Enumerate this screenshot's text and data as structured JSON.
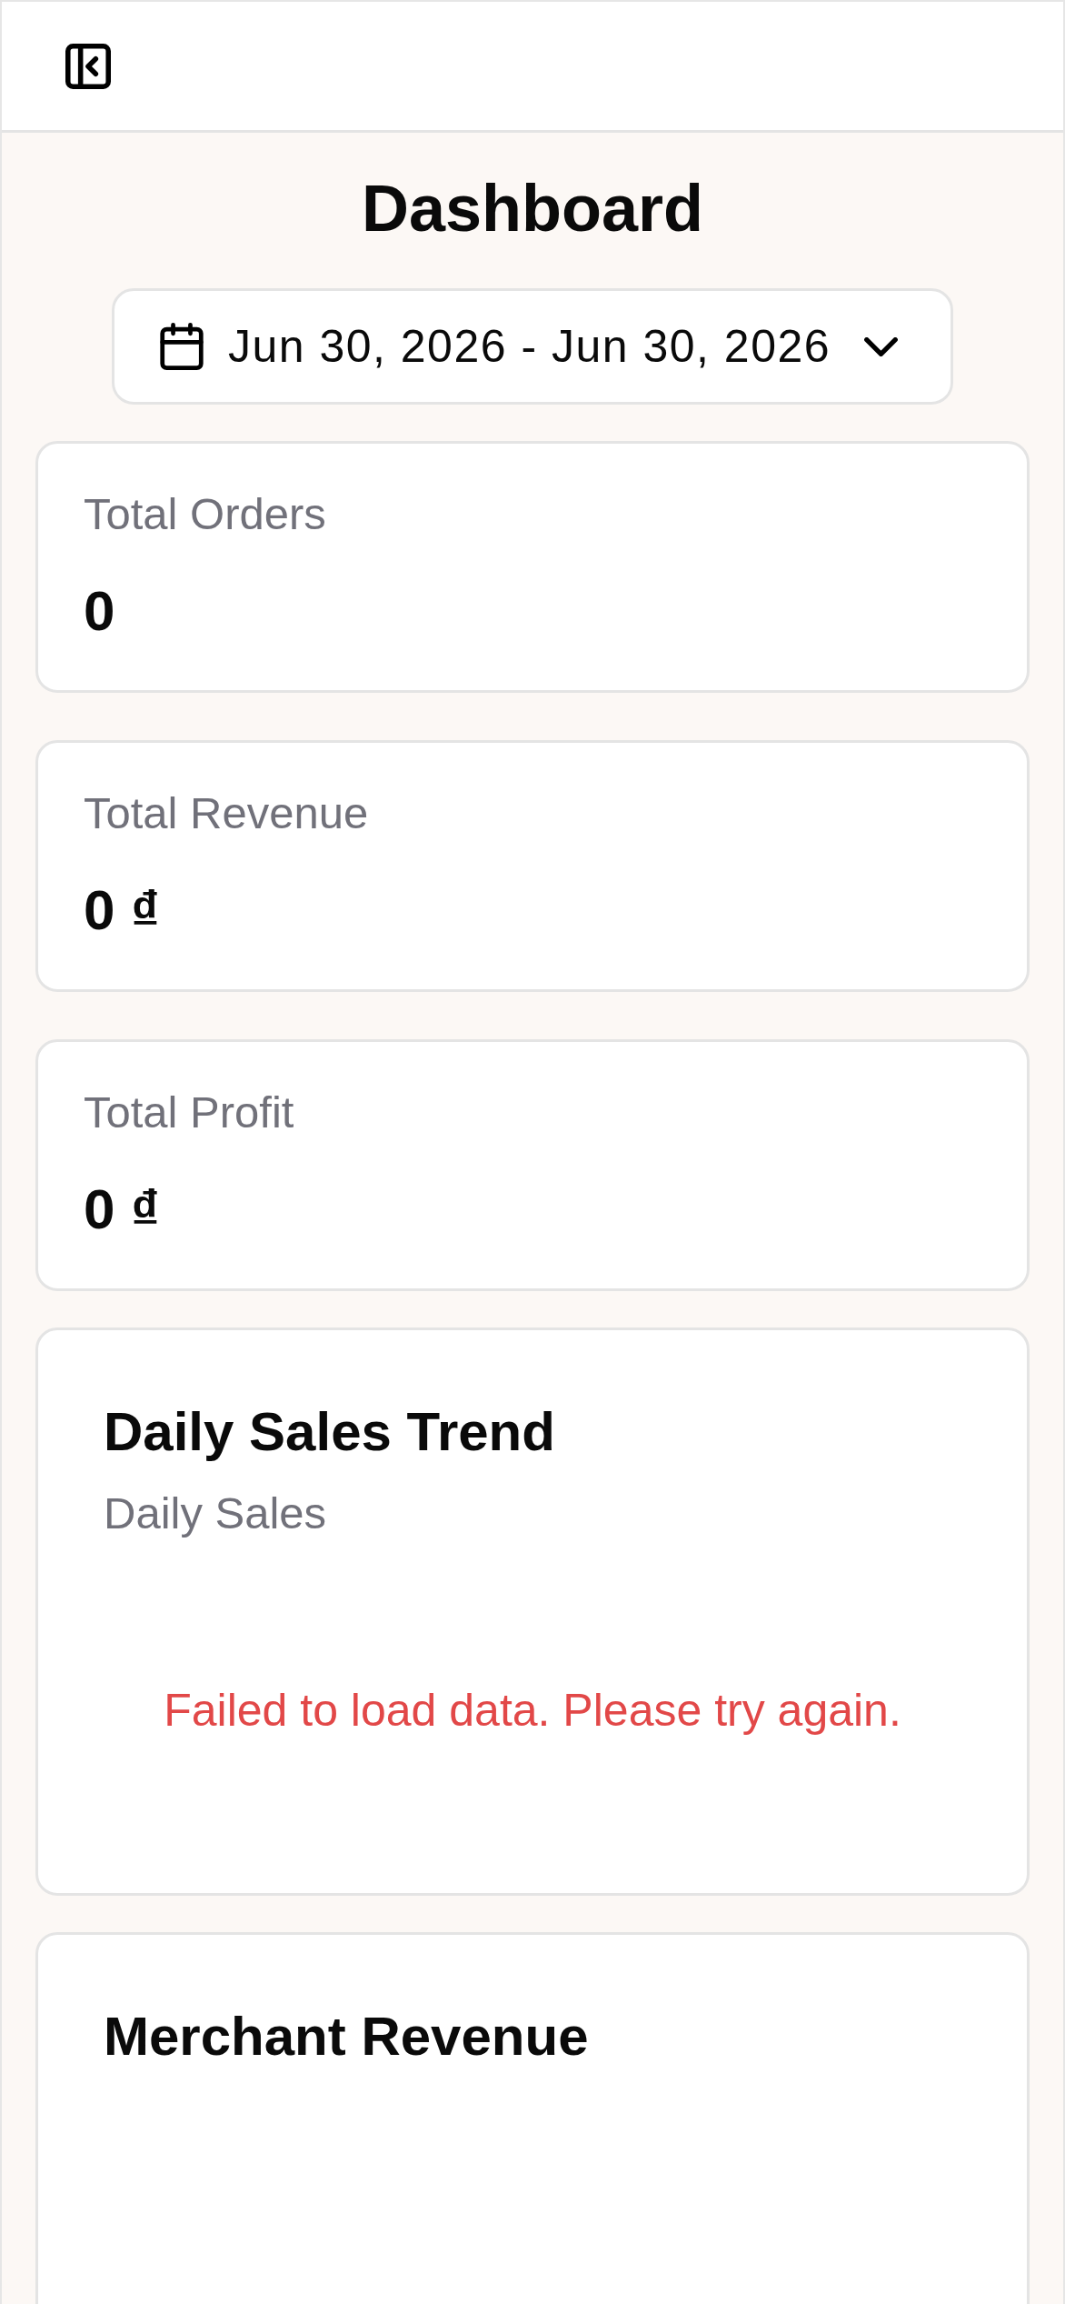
{
  "page": {
    "title": "Dashboard"
  },
  "date_range": {
    "value": "Jun 30, 2026 - Jun 30, 2026"
  },
  "stats": [
    {
      "label": "Total Orders",
      "value": "0"
    },
    {
      "label": "Total Revenue",
      "value": "0 ₫"
    },
    {
      "label": "Total Profit",
      "value": "0 ₫"
    }
  ],
  "charts": [
    {
      "title": "Daily Sales Trend",
      "subtitle": "Daily Sales",
      "error": "Failed to load data. Please try again."
    },
    {
      "title": "Merchant Revenue"
    }
  ]
}
